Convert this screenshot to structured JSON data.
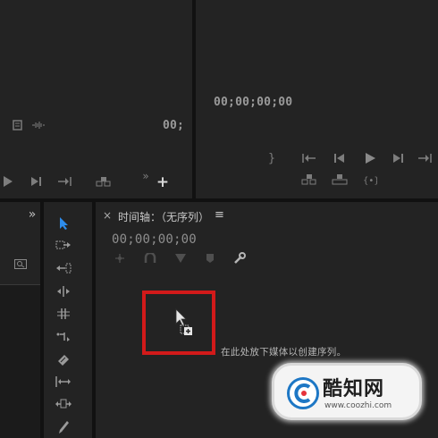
{
  "source_monitor": {
    "timecode": "00;",
    "add_button": "+"
  },
  "program_monitor": {
    "timecode": "00;00;00;00"
  },
  "project_panel": {
    "expand": "»"
  },
  "timeline": {
    "close": "×",
    "title": "时间轴：（无序列）",
    "menu": "≡",
    "timecode": "00;00;00;00",
    "drop_hint": "在此处放下媒体以创建序列。"
  },
  "watermark": {
    "name": "酷知网",
    "url": "www.coozhi.com"
  },
  "colors": {
    "accent_blue": "#2d8ceb",
    "highlight_red": "#d21a1a",
    "panel_bg": "#232323"
  }
}
